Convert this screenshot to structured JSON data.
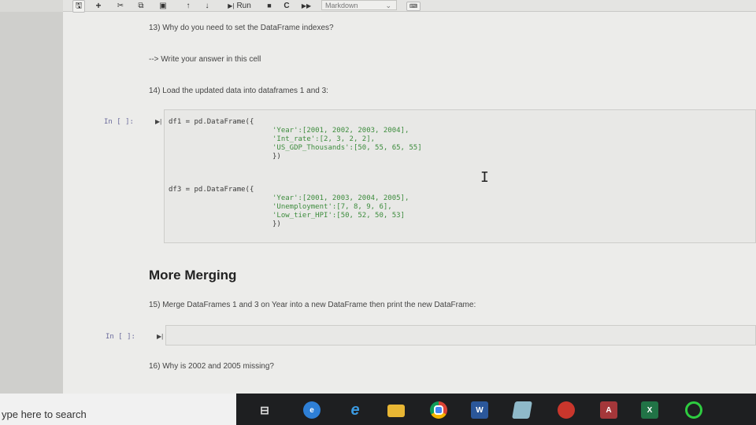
{
  "toolbar": {
    "run_label": "Run",
    "cell_type": "Markdown"
  },
  "cells": {
    "q13": "13) Why do you need to set the DataFrame indexes?",
    "answer_hint": "--> Write your answer in this cell",
    "q14": "14) Load the updated data into dataframes 1 and 3:",
    "prompt": "In [ ]:",
    "code_lines": [
      "df1 = pd.DataFrame({",
      "'Year':[2001, 2002, 2003, 2004],",
      "'Int_rate':[2, 3, 2, 2],",
      "'US_GDP_Thousands':[50, 55, 65, 55]",
      "})",
      "df3 = pd.DataFrame({",
      "'Year':[2001, 2003, 2004, 2005],",
      "'Unemployment':[7, 8, 9, 6],",
      "'Low_tier_HPI':[50, 52, 50, 53]",
      "})"
    ],
    "heading": "More Merging",
    "q15": "15) Merge DataFrames 1 and 3 on Year into a new DataFrame then print the new DataFrame:",
    "q16": "16) Why is 2002 and 2005 missing?"
  },
  "taskbar": {
    "search_text": "ype here to search",
    "word_letter": "W",
    "access_letter": "A",
    "excel_letter": "X"
  },
  "icons": [
    "save-icon",
    "plus-icon",
    "cut-icon",
    "copy-icon",
    "paste-icon",
    "up-arrow-icon",
    "down-arrow-icon",
    "run-icon",
    "stop-icon",
    "restart-icon",
    "fast-forward-icon",
    "keyboard-icon",
    "task-view-icon",
    "edge-icon",
    "ie-icon",
    "file-explorer-icon",
    "chrome-icon",
    "word-icon",
    "photos-icon",
    "app-icon",
    "access-icon",
    "excel-icon",
    "xbox-icon"
  ]
}
